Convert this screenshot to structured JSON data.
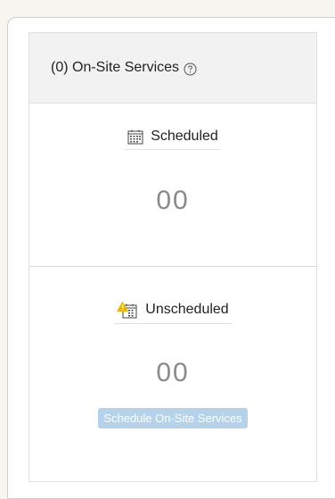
{
  "header": {
    "title": "(0) On-Site Services",
    "help_icon": "help-circle-icon"
  },
  "scheduled": {
    "label": "Scheduled",
    "icon": "calendar-icon",
    "count": "00"
  },
  "unscheduled": {
    "label": "Unscheduled",
    "icon": "calendar-warning-icon",
    "count": "00",
    "button_label": "Schedule On-Site Services"
  },
  "colors": {
    "warning": "#f0b400",
    "button_bg": "#b4d2ea",
    "count_text": "#8a8a8a"
  }
}
